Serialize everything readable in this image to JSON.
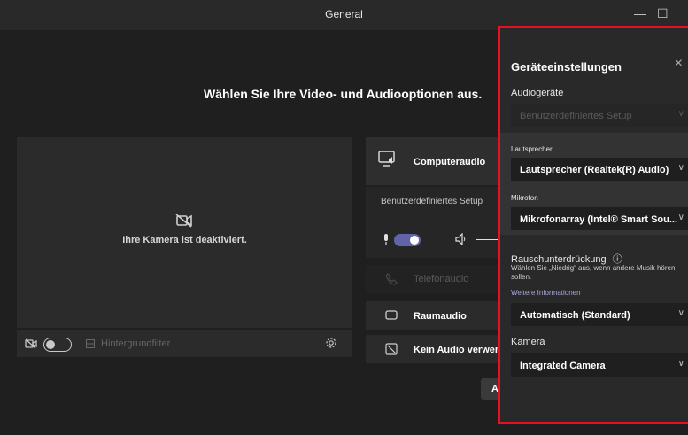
{
  "window": {
    "title": "General",
    "minimize": "—",
    "maximize": "☐"
  },
  "main": {
    "heading": "Wählen Sie Ihre Video- und Audiooptionen aus.",
    "camera_status": "Ihre Kamera ist deaktiviert.",
    "background_filter": "Hintergrundfilter",
    "join_partial": "A"
  },
  "audio_options": {
    "computer_audio": "Computeraudio",
    "custom_setup": "Benutzerdefiniertes Setup",
    "phone_audio": "Telefonaudio",
    "room_audio": "Raumaudio",
    "no_audio": "Kein Audio verwenden"
  },
  "device_settings": {
    "title": "Geräteeinstellungen",
    "close": "×",
    "audio_devices_label": "Audiogeräte",
    "audio_devices_value": "Benutzerdefiniertes Setup",
    "speaker_label": "Lautsprecher",
    "speaker_value": "Lautsprecher (Realtek(R) Audio)",
    "mic_label": "Mikrofon",
    "mic_value": "Mikrofonarray (Intel® Smart Sou...",
    "noise_label": "Rauschunterdrückung",
    "noise_info_icon": "ⓘ",
    "noise_desc": "Wählen Sie „Niedrig“ aus, wenn andere Musik hören sollen.",
    "more_info": "Weitere Informationen",
    "noise_value": "Automatisch (Standard)",
    "camera_label": "Kamera",
    "camera_value": "Integrated Camera"
  },
  "colors": {
    "accent": "#6264a7",
    "highlight_border": "#e81123",
    "link": "#a6a7dc"
  }
}
